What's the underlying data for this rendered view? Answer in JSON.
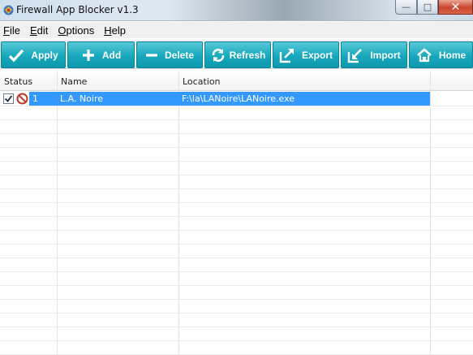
{
  "window": {
    "title": "Firewall App Blocker v1.3",
    "min_glyph": "—",
    "max_glyph": "□",
    "close_glyph": "✕"
  },
  "menu": {
    "items": [
      {
        "accel": "F",
        "rest": "ile"
      },
      {
        "accel": "E",
        "rest": "dit"
      },
      {
        "accel": "O",
        "rest": "ptions"
      },
      {
        "accel": "H",
        "rest": "elp"
      }
    ]
  },
  "toolbar": {
    "accent": "#17a8bd",
    "buttons": [
      {
        "label": "Apply",
        "icon": "check-icon"
      },
      {
        "label": "Add",
        "icon": "plus-icon"
      },
      {
        "label": "Delete",
        "icon": "minus-icon"
      },
      {
        "label": "Refresh",
        "icon": "refresh-icon"
      },
      {
        "label": "Export",
        "icon": "export-icon"
      },
      {
        "label": "Import",
        "icon": "import-icon"
      },
      {
        "label": "Home",
        "icon": "home-icon"
      }
    ]
  },
  "table": {
    "columns": [
      "Status",
      "Name",
      "Location"
    ],
    "rows": [
      {
        "checked": true,
        "status_icon": "blocked-icon",
        "index": "1",
        "name": "L.A. Noire",
        "location": "F:\\la\\LANoire\\LANoire.exe"
      }
    ],
    "selection_color": "#3399ff"
  }
}
